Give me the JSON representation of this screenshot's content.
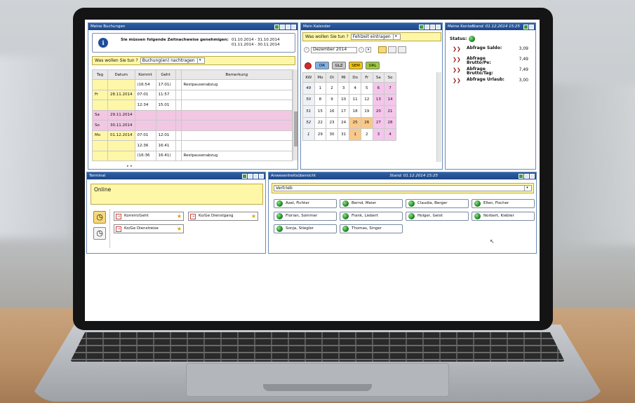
{
  "panels": {
    "buchungen": {
      "title": "Meine Buchungen"
    },
    "kalender": {
      "title": "Mein Kalender"
    },
    "konten": {
      "title": "Meine Konten",
      "stand": "Stand: 01.12.2014 15:25"
    },
    "terminal": {
      "title": "Terminal"
    },
    "anwesenheit": {
      "title": "Anwesenheitsübersicht",
      "stand": "Stand: 01.12.2014 15:25"
    }
  },
  "buchungen": {
    "notice": "Sie müssen folgende Zeitnachweise genehmigen:",
    "periods": [
      "01.10.2014 - 31.10.2014",
      "01.11.2014 - 30.11.2014"
    ],
    "prompt": "Was wollen Sie tun ?",
    "action": "Buchung(en) nachtragen",
    "columns": [
      "Tag",
      "Datum",
      "Kommt",
      "Geht",
      "Bemerkung"
    ],
    "rows": [
      {
        "tag": "",
        "datum": "",
        "kommt": "(16:54",
        "geht": "17:01)",
        "bem": "Restpausenabzug",
        "pink": false
      },
      {
        "tag": "Fr",
        "datum": "28.11.2014",
        "kommt": "07:01",
        "geht": "11:57",
        "bem": "",
        "pink": false
      },
      {
        "tag": "",
        "datum": "",
        "kommt": "12:34",
        "geht": "15:01",
        "bem": "",
        "pink": false
      },
      {
        "tag": "Sa",
        "datum": "29.11.2014",
        "kommt": "",
        "geht": "",
        "bem": "",
        "pink": true
      },
      {
        "tag": "So",
        "datum": "30.11.2014",
        "kommt": "",
        "geht": "",
        "bem": "",
        "pink": true
      },
      {
        "tag": "Mo",
        "datum": "01.12.2014",
        "kommt": "07:01",
        "geht": "12:01",
        "bem": "",
        "pink": false
      },
      {
        "tag": "",
        "datum": "",
        "kommt": "12:36",
        "geht": "16:41",
        "bem": "",
        "pink": false
      },
      {
        "tag": "",
        "datum": "",
        "kommt": "(16:36",
        "geht": "16:41)",
        "bem": "Restpausenabzug",
        "pink": false
      }
    ]
  },
  "kalender": {
    "prompt": "Was wollen Sie tun ?",
    "action": "Fehlzeit eintragen",
    "month": "Dezember 2014",
    "buttons": [
      {
        "label": "DR",
        "color": "#7fb2e8"
      },
      {
        "label": "GLZ",
        "color": "#c8c8c8"
      },
      {
        "label": "SEM",
        "color": "#f5c400"
      },
      {
        "label": "URL",
        "color": "#9ccc3c"
      }
    ],
    "headers": [
      "KW",
      "Mo",
      "Di",
      "Mi",
      "Do",
      "Fr",
      "Sa",
      "So"
    ],
    "weeks": [
      {
        "kw": "49",
        "days": [
          "1",
          "2",
          "3",
          "4",
          "5",
          "6",
          "7"
        ]
      },
      {
        "kw": "50",
        "days": [
          "8",
          "9",
          "10",
          "11",
          "12",
          "13",
          "14"
        ]
      },
      {
        "kw": "51",
        "days": [
          "15",
          "16",
          "17",
          "18",
          "19",
          "20",
          "21"
        ]
      },
      {
        "kw": "52",
        "days": [
          "22",
          "23",
          "24",
          "25",
          "26",
          "27",
          "28"
        ]
      },
      {
        "kw": "1",
        "days": [
          "29",
          "30",
          "31",
          "1",
          "2",
          "3",
          "4"
        ]
      }
    ]
  },
  "konten": {
    "status_label": "Status:",
    "items": [
      {
        "label": "Abfrage Saldo:",
        "value": "3,09"
      },
      {
        "label": "Abfrage Brutto/Pe:",
        "value": "7,49"
      },
      {
        "label": "Abfrage Brutto/Tag:",
        "value": "7,49"
      },
      {
        "label": "Abfrage Urlaub:",
        "value": "3,00"
      }
    ]
  },
  "terminal": {
    "status": "Online",
    "buttons": [
      "Kommt/Geht",
      "Ko/Ge Dienstgang",
      "Ko/Ge Dienstreise"
    ]
  },
  "anwesenheit": {
    "department": "Vertrieb",
    "people": [
      "Axel, Fichter",
      "Bernd, Meier",
      "Claudia, Berger",
      "Ellen, Fischer",
      "Florian, Sommer",
      "Frank, Liebert",
      "Holger, Geist",
      "Norbert, Kiebler",
      "Sonja, Stiegler",
      "Thomas, Singer"
    ]
  }
}
